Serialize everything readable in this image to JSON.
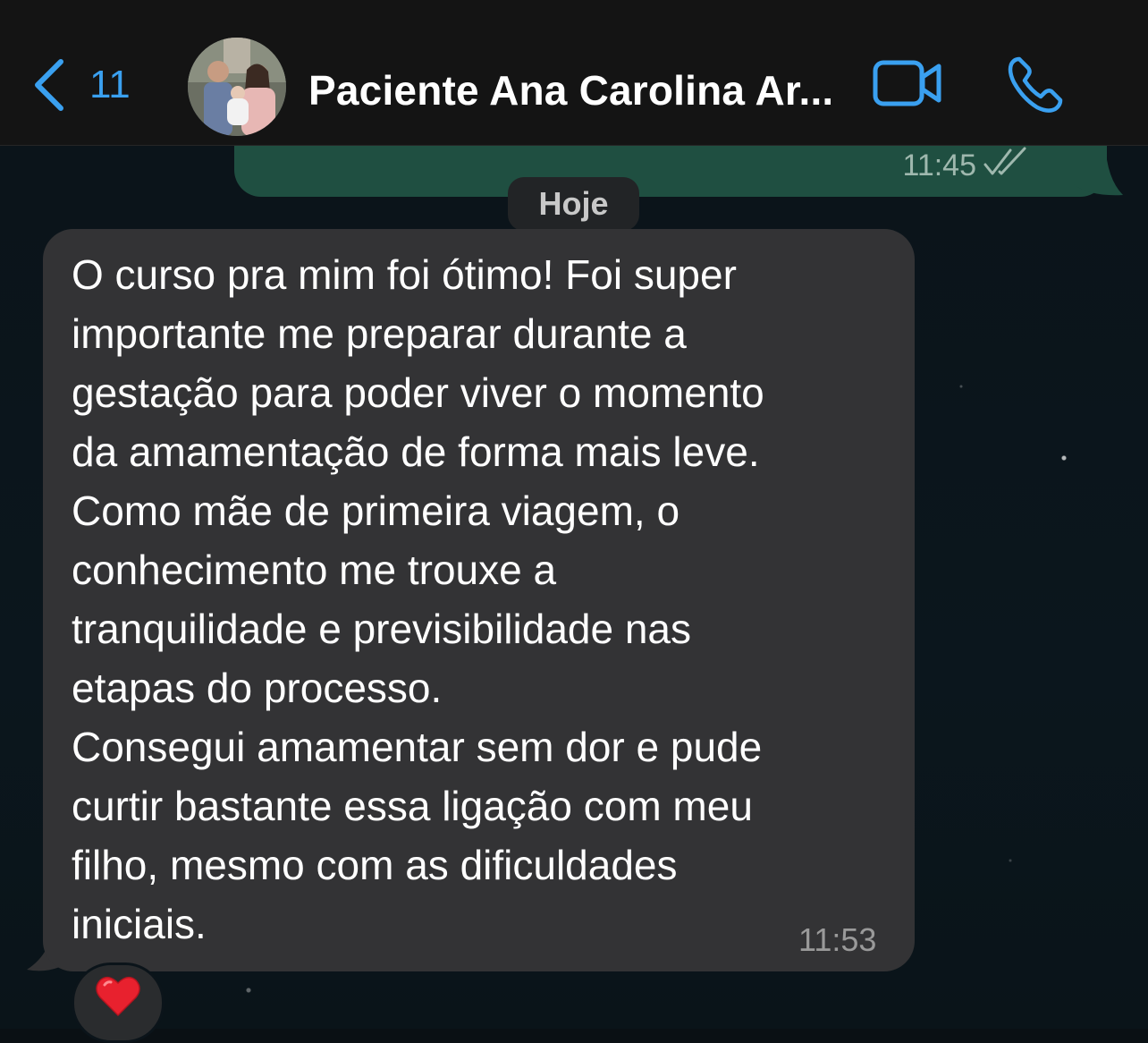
{
  "header": {
    "back_count": "11",
    "contact_name": "Paciente Ana Carolina Ar...",
    "avatar_alt": "contact avatar",
    "back_icon": "chevron-left-icon",
    "video_icon": "video-camera-icon",
    "call_icon": "phone-icon"
  },
  "chat": {
    "date_separator": "Hoje",
    "outgoing": {
      "time": "11:45",
      "status_icon": "double-check-icon"
    },
    "incoming": {
      "text": "O curso pra mim foi ótimo! Foi super\nimportante me preparar durante a\ngestação para poder viver o momento\nda amamentação de forma mais leve.\nComo mãe de primeira viagem, o\nconhecimento me trouxe a\ntranquilidade e previsibilidade nas\netapas do processo.\nConsegui amamentar sem dor e pude\ncurtir bastante essa ligação com meu\nfilho, mesmo com as dificuldades\niniciais.",
      "time": "11:53",
      "reaction": "❤️"
    }
  },
  "colors": {
    "accent": "#3aa0f0",
    "outgoing_bubble": "#1f4f41",
    "incoming_bubble": "#333335",
    "header_bg": "#141414"
  }
}
